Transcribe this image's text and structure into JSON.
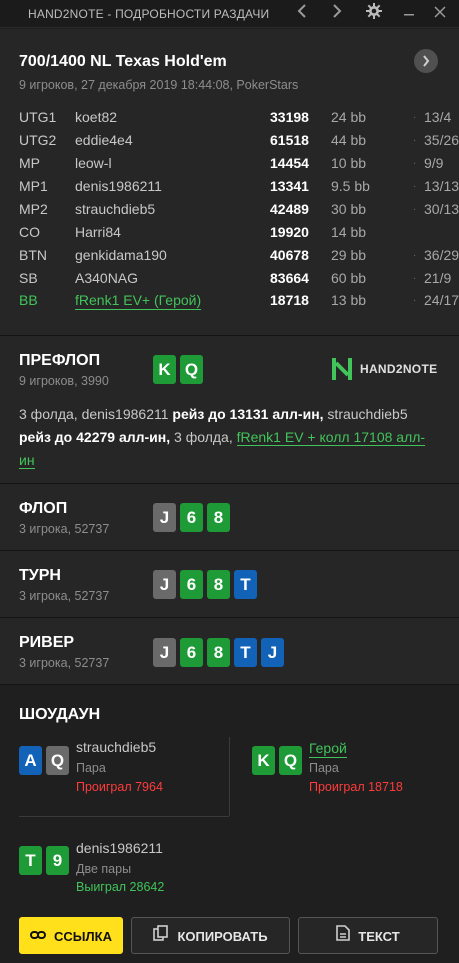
{
  "titlebar": {
    "title": "HAND2NOTE - ПОДРОБНОСТИ РАЗДАЧИ"
  },
  "header": {
    "title": "700/1400 NL Texas Hold'em",
    "subtitle": "9 игроков, 27 декабря 2019 18:44:08, PokerStars"
  },
  "players": [
    {
      "pos": "UTG1",
      "name": "koet82",
      "stack": "33198",
      "bb": "24 bb",
      "dot": "·",
      "vpip": "13/4"
    },
    {
      "pos": "UTG2",
      "name": "eddie4e4",
      "stack": "61518",
      "bb": "44 bb",
      "dot": "·",
      "vpip": "35/26"
    },
    {
      "pos": "MP",
      "name": "leow-l",
      "stack": "14454",
      "bb": "10 bb",
      "dot": "·",
      "vpip": "9/9"
    },
    {
      "pos": "MP1",
      "name": "denis1986211",
      "stack": "13341",
      "bb": "9.5 bb",
      "dot": "·",
      "vpip": "13/13"
    },
    {
      "pos": "MP2",
      "name": "strauchdieb5",
      "stack": "42489",
      "bb": "30 bb",
      "dot": "·",
      "vpip": "30/13"
    },
    {
      "pos": "CO",
      "name": "Harri84",
      "stack": "19920",
      "bb": "14 bb",
      "dot": "",
      "vpip": ""
    },
    {
      "pos": "BTN",
      "name": "genkidama190",
      "stack": "40678",
      "bb": "29 bb",
      "dot": "·",
      "vpip": "36/29"
    },
    {
      "pos": "SB",
      "name": "A340NAG",
      "stack": "83664",
      "bb": "60 bb",
      "dot": "·",
      "vpip": "21/9"
    },
    {
      "pos": "BB",
      "name": "fRenk1 EV+ (Герой)",
      "stack": "18718",
      "bb": "13 bb",
      "dot": "·",
      "vpip": "24/17"
    }
  ],
  "preflop": {
    "title": "ПРЕФЛОП",
    "sub": "9 игроков, 3990",
    "cards": [
      "K",
      "Q"
    ],
    "logo_text": "HAND2NOTE",
    "action": {
      "p1": "3 фолда, denis1986211 ",
      "b1": "рейз до 13131 алл-ин,",
      "p2": " strauchdieb5 ",
      "b2": "рейз до 42279 алл-ин,",
      "p3": " 3 фолда, ",
      "hero": "fRenk1 EV + колл 17108 алл-ин"
    }
  },
  "flop": {
    "title": "ФЛОП",
    "sub": "3 игрока, 52737",
    "cards": [
      "J",
      "6",
      "8"
    ]
  },
  "turn": {
    "title": "ТУРН",
    "sub": "3 игрока, 52737",
    "cards": [
      "J",
      "6",
      "8",
      "T"
    ]
  },
  "river": {
    "title": "РИВЕР",
    "sub": "3 игрока, 52737",
    "cards": [
      "J",
      "6",
      "8",
      "T",
      "J"
    ]
  },
  "showdown": {
    "title": "ШОУДАУН",
    "players": [
      {
        "cards": [
          "A",
          "Q"
        ],
        "name": "strauchdieb5",
        "hand": "Пара",
        "result": "Проиграл 7964"
      },
      {
        "cards": [
          "K",
          "Q"
        ],
        "name": "Герой",
        "hand": "Пара",
        "result": "Проиграл 18718"
      },
      {
        "cards": [
          "T",
          "9"
        ],
        "name": "denis1986211",
        "hand": "Две пары",
        "result": "Выиграл 28642"
      }
    ]
  },
  "buttons": {
    "link": "ССЫЛКА",
    "copy": "КОПИРОВАТЬ",
    "text": "ТЕКСТ"
  },
  "colors": {
    "hero_green": "#41c45a",
    "loss_red": "#ff3b3b",
    "card_green": "#1e9a36",
    "card_blue": "#1262b8",
    "card_red": "#d11f1f",
    "card_gray": "#6a6a6a",
    "primary_yellow": "#ffe01b"
  }
}
